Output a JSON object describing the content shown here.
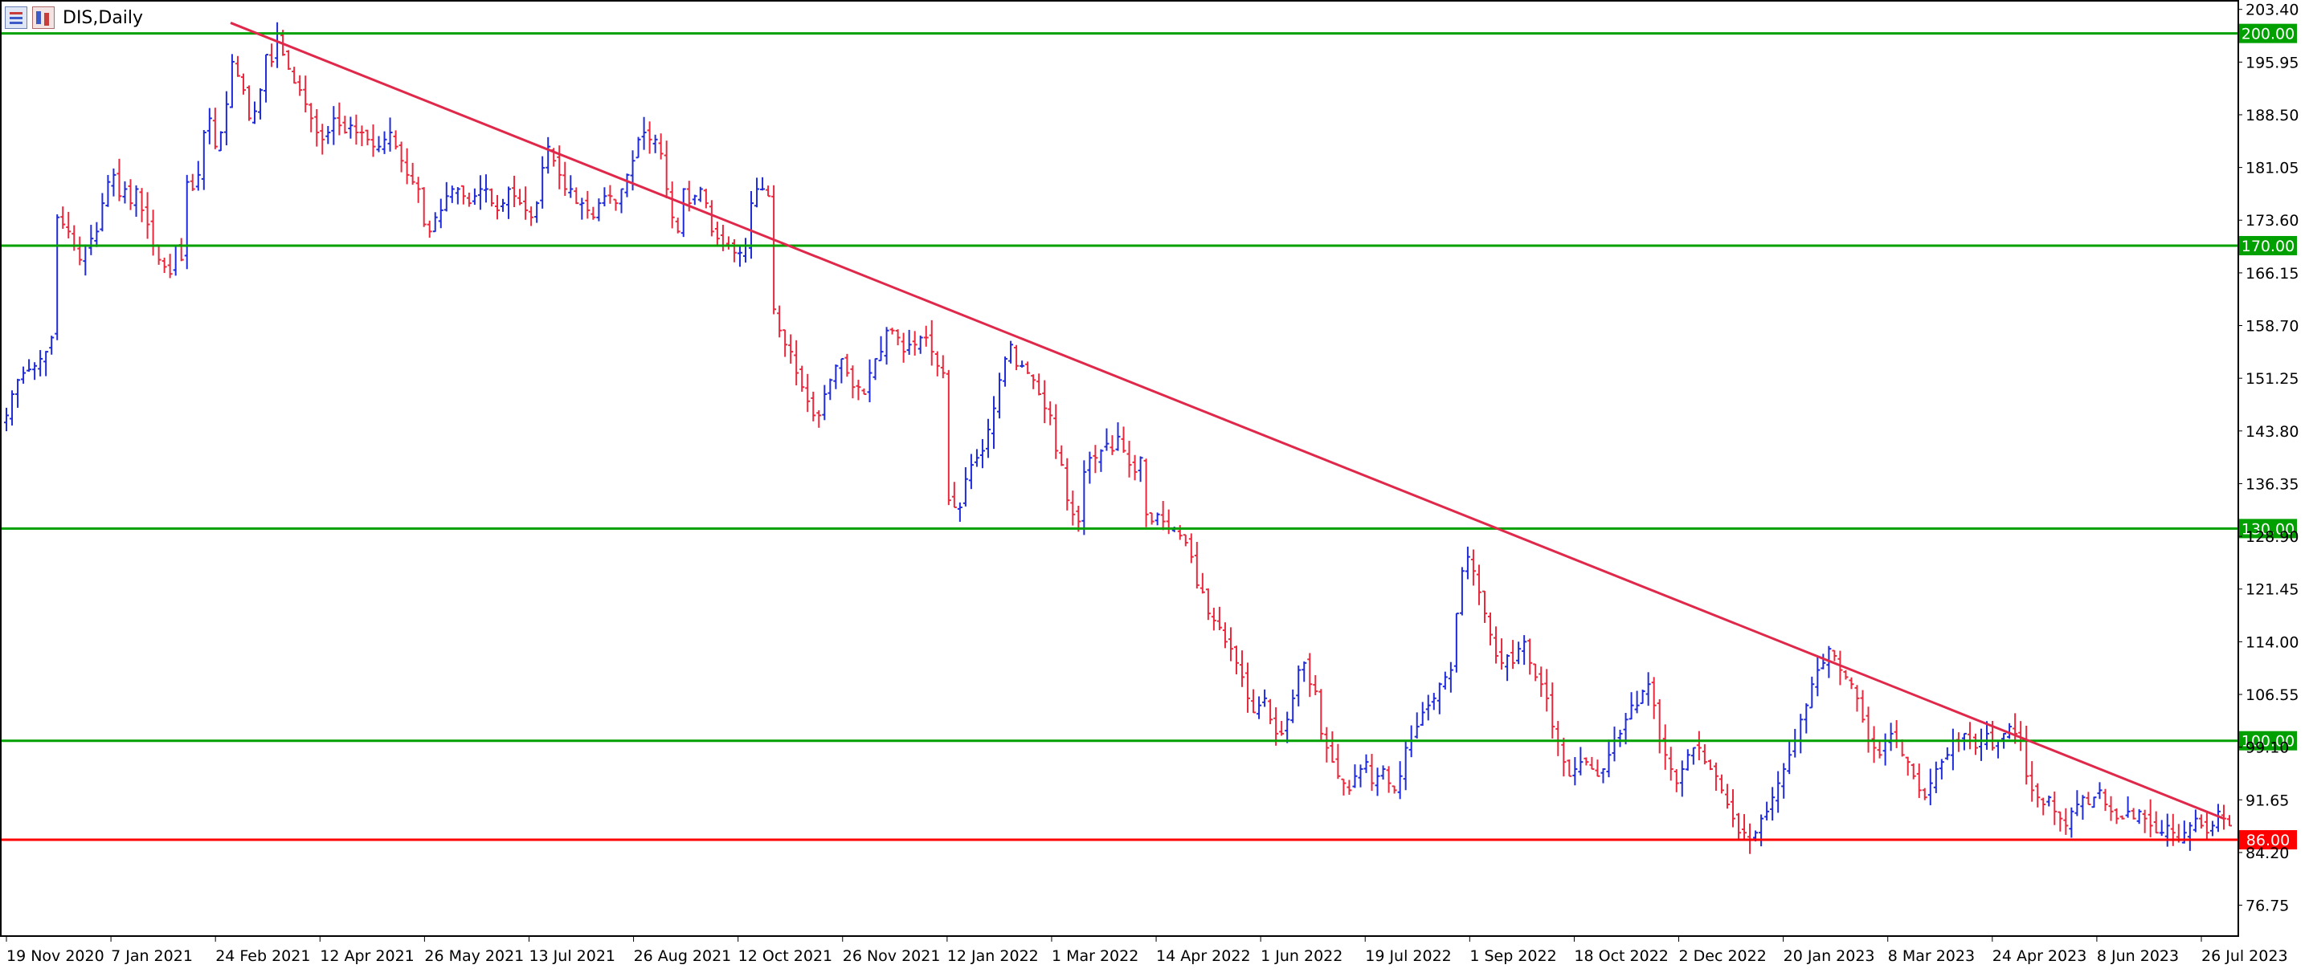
{
  "toolbar": {
    "symbol": "DIS,Daily",
    "icons": [
      "chart-bars-icon",
      "chart-candles-icon"
    ]
  },
  "chart_data": {
    "type": "bar",
    "style": "ohlc-bars",
    "symbol": "DIS",
    "timeframe": "Daily",
    "title": "DIS,Daily",
    "ylim": [
      72.5,
      204.5
    ],
    "y_ticks": [
      "203.40",
      "195.95",
      "188.50",
      "181.05",
      "173.60",
      "166.15",
      "158.70",
      "151.25",
      "143.80",
      "136.35",
      "128.90",
      "121.45",
      "114.00",
      "106.55",
      "99.10",
      "91.65",
      "84.20",
      "76.75"
    ],
    "x_ticks": [
      "19 Nov 2020",
      "7 Jan 2021",
      "24 Feb 2021",
      "12 Apr 2021",
      "26 May 2021",
      "13 Jul 2021",
      "26 Aug 2021",
      "12 Oct 2021",
      "26 Nov 2021",
      "12 Jan 2022",
      "1 Mar 2022",
      "14 Apr 2022",
      "1 Jun 2022",
      "19 Jul 2022",
      "1 Sep 2022",
      "18 Oct 2022",
      "2 Dec 2022",
      "20 Jan 2023",
      "8 Mar 2023",
      "24 Apr 2023",
      "8 Jun 2023",
      "26 Jul 2023"
    ],
    "series_colors": {
      "up": "#1f2bd8",
      "down": "#e8283c"
    },
    "series": [
      {
        "name": "",
        "values": [
          146,
          149,
          151,
          152,
          152.5,
          153,
          154,
          155,
          157,
          174,
          173,
          172,
          170,
          168,
          170,
          171,
          172,
          176,
          179,
          180,
          177,
          178,
          176,
          178,
          175,
          173,
          170,
          168,
          167,
          166,
          170,
          168,
          179,
          178,
          180,
          186,
          188,
          184,
          186,
          190,
          196,
          194,
          192,
          188,
          189,
          192,
          197,
          196,
          200,
          197,
          195,
          193,
          192,
          190,
          188,
          186,
          185,
          186,
          188,
          187,
          186,
          187,
          186,
          186,
          185,
          184,
          184,
          185,
          186,
          184,
          182,
          180,
          179,
          178,
          173,
          172,
          174,
          175,
          177,
          178,
          178,
          177,
          176,
          177,
          178,
          178,
          176,
          175,
          176,
          178,
          177,
          176,
          175,
          174,
          176,
          181,
          184,
          182,
          180,
          178,
          178,
          176,
          176,
          175,
          174,
          176,
          177,
          177,
          176,
          178,
          180,
          182,
          185,
          186,
          185,
          185,
          183,
          178,
          174,
          172,
          178,
          176,
          177,
          178,
          176,
          172,
          171,
          170,
          170,
          169,
          169,
          170,
          176,
          178,
          178,
          177,
          161,
          158,
          156,
          155,
          152,
          150,
          148,
          146,
          146,
          149,
          151,
          153,
          154,
          152,
          150,
          150,
          149,
          152,
          154,
          155,
          158,
          158,
          157,
          155,
          156,
          156,
          157,
          157,
          155,
          153,
          152,
          134,
          133,
          133,
          137,
          139,
          140,
          141,
          144,
          147,
          151,
          154,
          156,
          153,
          153,
          152,
          151,
          149,
          147,
          146,
          141,
          139,
          134,
          132,
          131,
          138,
          140,
          140,
          141,
          142,
          141,
          143,
          141,
          139,
          138,
          140,
          132,
          131,
          132,
          131,
          130,
          130,
          129,
          128,
          126,
          122,
          121,
          118,
          117,
          116,
          114,
          113,
          111,
          109,
          106,
          104,
          105,
          106,
          103,
          101,
          101,
          103,
          106,
          110,
          111,
          108,
          107,
          101,
          99,
          97,
          95,
          94,
          93,
          95,
          96,
          97,
          94,
          95,
          96,
          94,
          93,
          95,
          99,
          100,
          102,
          104,
          105,
          106,
          108,
          109,
          110,
          118,
          124,
          126,
          124,
          121,
          118,
          115,
          112,
          111,
          112,
          111,
          113,
          114,
          111,
          109,
          108,
          106,
          102,
          100,
          97,
          95,
          96,
          97,
          97,
          96,
          95,
          96,
          98,
          100,
          101,
          103,
          105,
          105,
          107,
          108,
          105,
          100,
          98,
          96,
          94,
          96,
          98,
          99,
          99,
          97,
          96,
          95,
          93,
          91,
          89,
          87,
          87,
          86,
          87,
          89,
          90,
          92,
          94,
          96,
          98,
          100,
          103,
          105,
          108,
          110,
          111,
          113,
          112,
          110,
          109,
          108,
          106,
          103,
          100,
          99,
          98,
          100,
          101,
          100,
          98,
          97,
          95,
          93,
          92,
          94,
          96,
          97,
          98,
          100,
          100,
          101,
          100,
          99,
          100,
          101,
          99,
          100,
          101,
          102,
          101,
          100,
          95,
          93,
          92,
          91,
          92,
          90,
          89,
          88,
          90,
          91,
          92,
          91,
          92,
          93,
          91,
          90,
          89,
          89,
          90,
          89,
          90,
          89,
          88,
          87,
          87,
          88,
          87,
          86,
          87,
          88,
          89,
          88,
          87,
          88,
          90,
          89,
          88
        ]
      }
    ],
    "horizontal_levels": [
      {
        "value": 200.0,
        "label": "200.00",
        "color": "#00a000"
      },
      {
        "value": 170.0,
        "label": "170.00",
        "color": "#00a000"
      },
      {
        "value": 130.0,
        "label": "130.00",
        "color": "#00a000"
      },
      {
        "value": 100.0,
        "label": "100.00",
        "color": "#00a000"
      },
      {
        "value": 86.0,
        "label": "86.00",
        "color": "#ff0000"
      }
    ],
    "trendline": {
      "from_date": "24 Feb 2021",
      "from_value": 201.5,
      "to_date": "26 Jul 2023",
      "to_value": 89.0,
      "color": "#e0284a"
    },
    "grid": false
  }
}
